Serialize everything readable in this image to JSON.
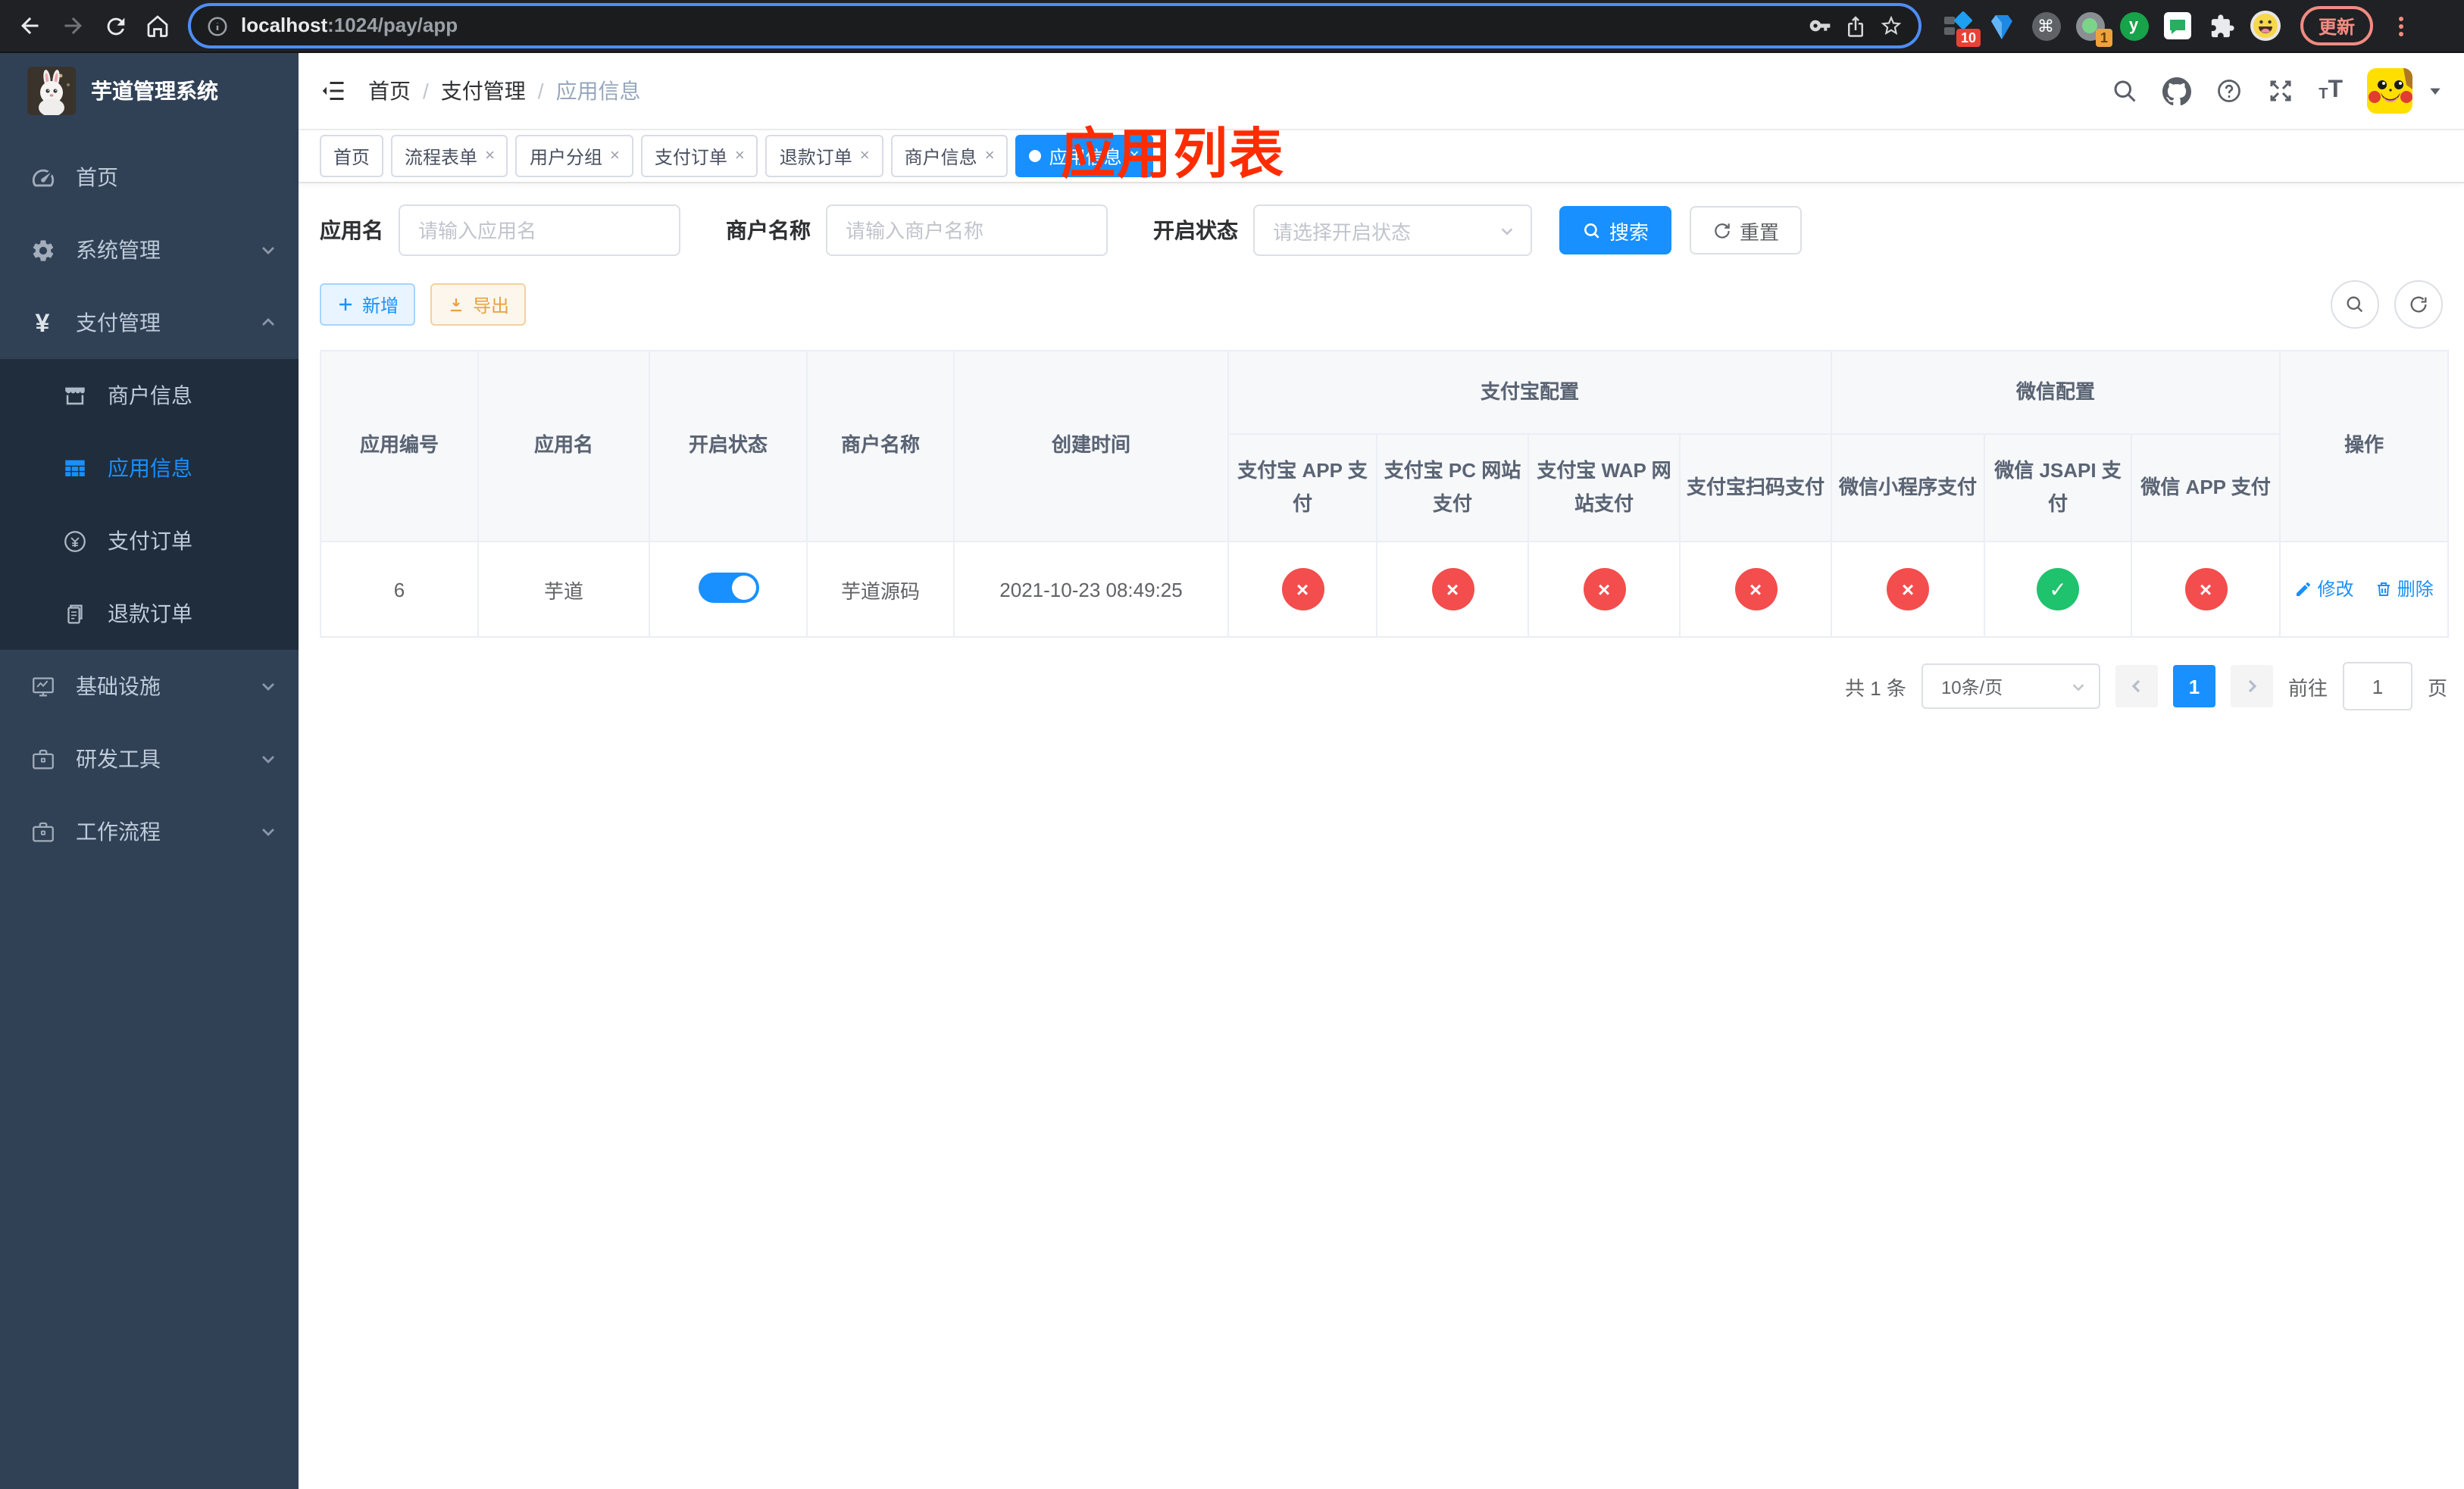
{
  "colors": {
    "accent": "#1890ff",
    "ok": "#1fc26d",
    "fail": "#f34d4d",
    "annotation": "#ff2c00"
  },
  "browser": {
    "url": {
      "host": "localhost",
      "path": ":1024/pay/app"
    },
    "ext_badge_diamond": "10",
    "ext_badge_loom": "1",
    "ext_letter": "y",
    "cmd_glyph": "⌘",
    "update_button": "更新"
  },
  "sidebar": {
    "logo_title": "芋道管理系统",
    "menu": [
      {
        "label": "首页"
      },
      {
        "label": "系统管理"
      },
      {
        "label": "支付管理"
      },
      {
        "label": "商户信息"
      },
      {
        "label": "应用信息"
      },
      {
        "label": "支付订单"
      },
      {
        "label": "退款订单"
      },
      {
        "label": "基础设施"
      },
      {
        "label": "研发工具"
      },
      {
        "label": "工作流程"
      }
    ]
  },
  "header": {
    "breadcrumb": {
      "home": "首页",
      "section": "支付管理",
      "current": "应用信息"
    }
  },
  "annotation": {
    "text": "应用列表"
  },
  "tags": [
    {
      "label": "首页"
    },
    {
      "label": "流程表单"
    },
    {
      "label": "用户分组"
    },
    {
      "label": "支付订单"
    },
    {
      "label": "退款订单"
    },
    {
      "label": "商户信息"
    },
    {
      "label": "应用信息"
    }
  ],
  "filters": {
    "app_name_label": "应用名",
    "app_name_placeholder": "请输入应用名",
    "merchant_label": "商户名称",
    "merchant_placeholder": "请输入商户名称",
    "status_label": "开启状态",
    "status_placeholder": "请选择开启状态",
    "search": "搜索",
    "reset": "重置"
  },
  "toolbar": {
    "add": "新增",
    "export": "导出"
  },
  "table": {
    "headers": {
      "app_id": "应用编号",
      "app_name": "应用名",
      "status": "开启状态",
      "merchant_name": "商户名称",
      "create_time": "创建时间",
      "alipay_group": "支付宝配置",
      "wechat_group": "微信配置",
      "actions": "操作",
      "sub": [
        "支付宝 APP 支付",
        "支付宝 PC 网站支付",
        "支付宝 WAP 网站支付",
        "支付宝扫码支付",
        "微信小程序支付",
        "微信 JSAPI 支付",
        "微信 APP 支付"
      ]
    },
    "row": {
      "app_id": "6",
      "app_name": "芋道",
      "merchant_name": "芋道源码",
      "create_time": "2021-10-23 08:49:25",
      "channels": [
        "fail",
        "fail",
        "fail",
        "fail",
        "fail",
        "ok",
        "fail"
      ],
      "edit": "修改",
      "delete": "删除"
    }
  },
  "pagination": {
    "total": "共 1 条",
    "page_size": "10条/页",
    "current_page": "1",
    "goto_label": "前往",
    "goto_value": "1",
    "page_unit": "页"
  }
}
